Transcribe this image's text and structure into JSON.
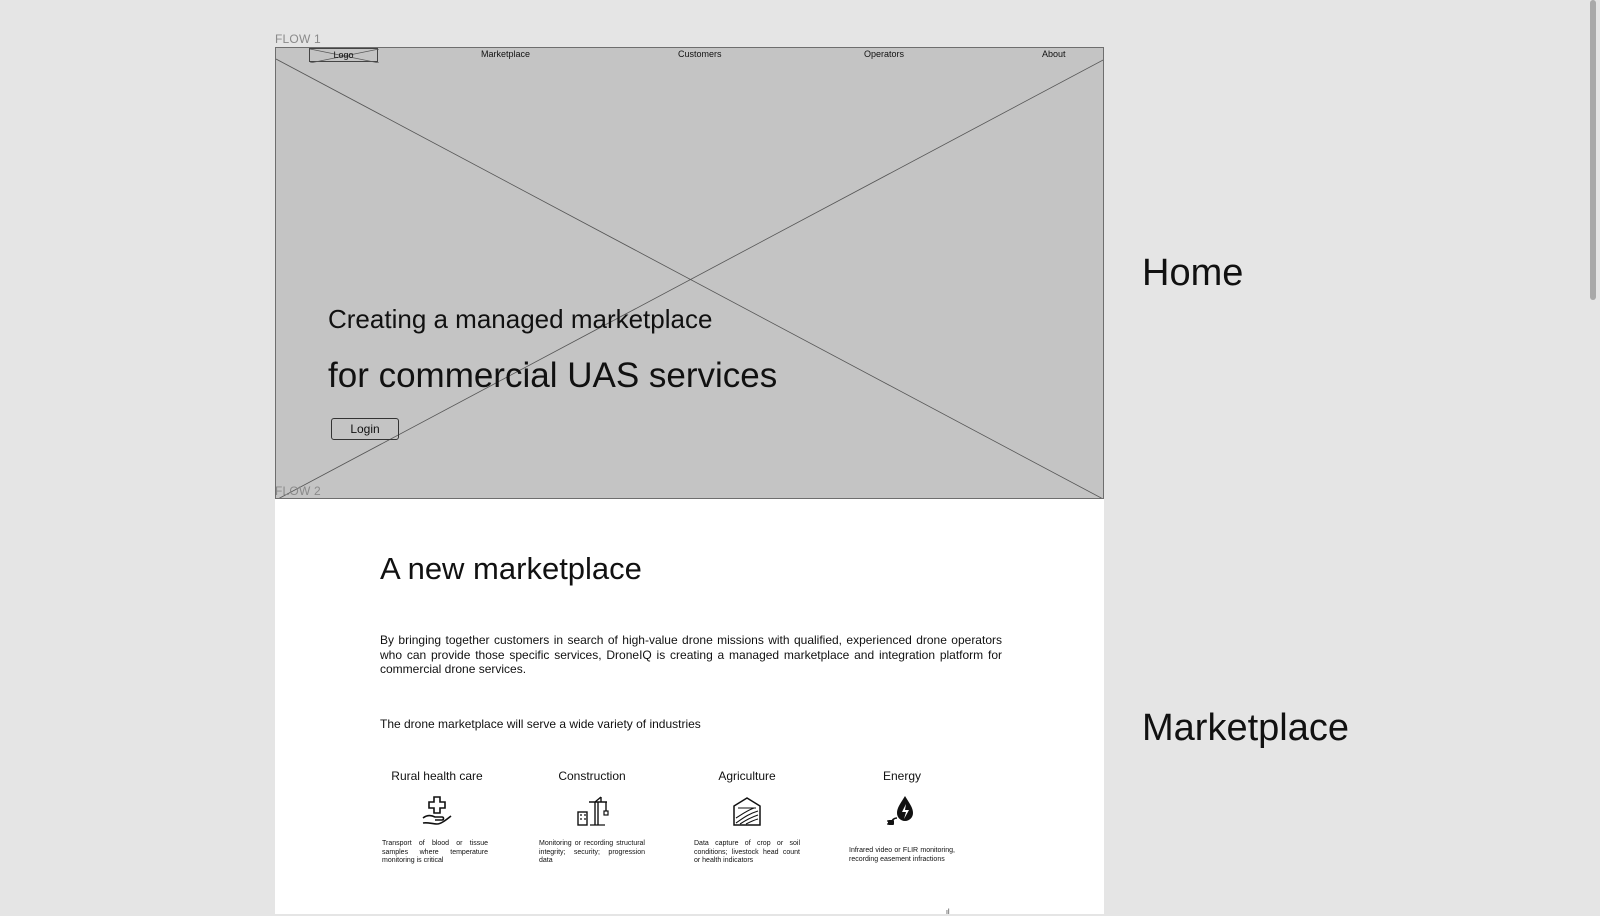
{
  "flows": {
    "flow1": "FLOW 1",
    "flow2": "FLOW 2"
  },
  "nav": {
    "logo": "Logo",
    "items": [
      "Marketplace",
      "Customers",
      "Operators",
      "About"
    ]
  },
  "hero": {
    "line1": "Creating a managed marketplace",
    "line2": "for commercial UAS services",
    "login_label": "Login"
  },
  "marketplace": {
    "title": "A new marketplace",
    "paragraph": "By bringing together customers in search of high-value drone missions with qualified, experienced drone operators who can provide those specific services, DroneIQ is creating a managed marketplace and integration platform for commercial drone services.",
    "subtitle": "The drone marketplace will serve a wide variety of industries",
    "industries": [
      {
        "name": "Rural health care",
        "icon": "hand-medical-cross-icon",
        "description": "Transport of blood or tissue samples where temperature monitoring is critical"
      },
      {
        "name": "Construction",
        "icon": "crane-building-icon",
        "description": "Monitoring or recording structural integrity; security; progression data"
      },
      {
        "name": "Agriculture",
        "icon": "barn-field-icon",
        "description": "Data capture of crop or soil conditions; livestock head count or health indicators"
      },
      {
        "name": "Energy",
        "icon": "energy-drop-plug-icon",
        "description": "Infrared video or FLIR monitoring, recording easement infractions"
      }
    ]
  },
  "section_labels": {
    "home": "Home",
    "marketplace": "Marketplace"
  },
  "colors": {
    "page_bg": "#e5e5e5",
    "hero_bg": "#c4c4c4",
    "frame_bg": "#ffffff",
    "text": "#111111"
  }
}
